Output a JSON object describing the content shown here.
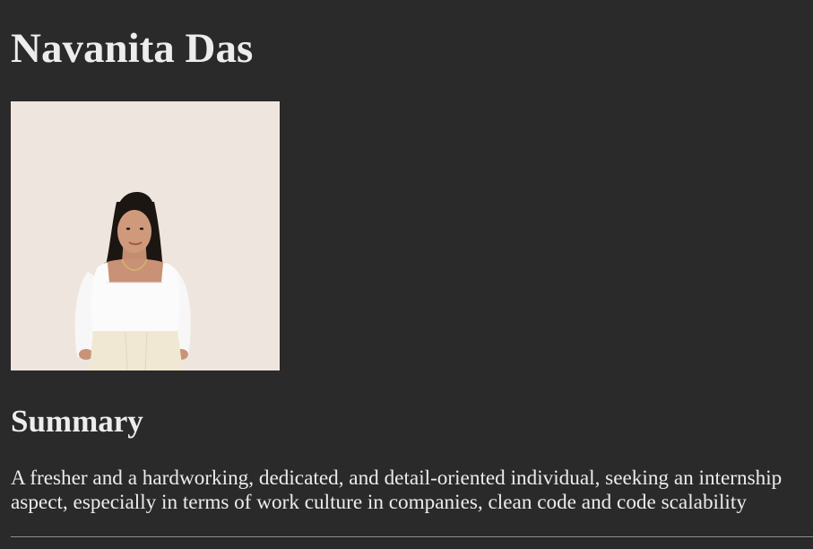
{
  "header": {
    "name": "Navanita Das"
  },
  "photo": {
    "background_color": "#efe5df"
  },
  "summary": {
    "heading": "Summary",
    "lines": [
      "A fresher and a hardworking, dedicated, and detail-oriented individual, seeking an internship",
      "aspect, especially in terms of work culture in companies, clean code and code scalability"
    ]
  },
  "colors": {
    "page_background": "#2a2a2a",
    "text": "#ececec"
  }
}
